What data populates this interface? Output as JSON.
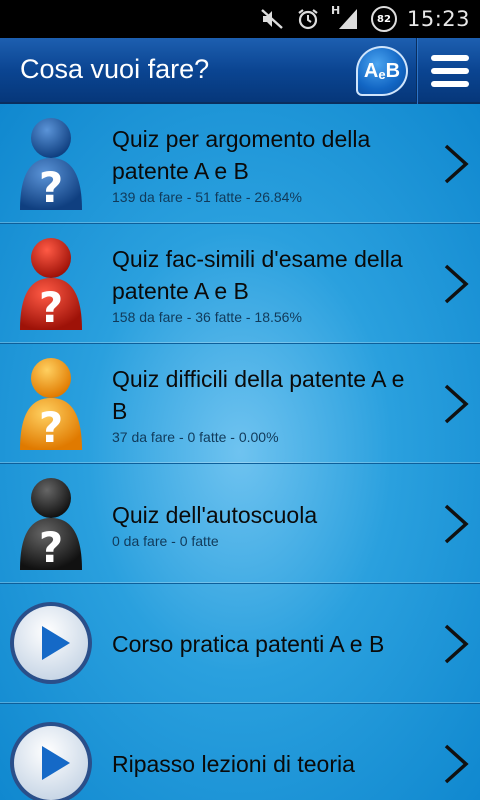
{
  "status_bar": {
    "icons": [
      "mute-icon",
      "alarm-icon",
      "signal-icon"
    ],
    "network_label": "H",
    "battery_level": "82",
    "time": "15:23"
  },
  "header": {
    "title": "Cosa vuoi fare?",
    "logo_text_main": "A",
    "logo_text_small": "e",
    "logo_text_end": "B",
    "menu_icon": "hamburger-menu-icon"
  },
  "colors": {
    "header_blue": "#0b4592",
    "list_background": "#2aa0de",
    "avatar_blue": "#1f5fae",
    "avatar_red": "#d42a1a",
    "avatar_orange": "#f59a12",
    "avatar_black": "#2a2a2a"
  },
  "rows": [
    {
      "type": "quiz",
      "avatar_color": "#1f5fae",
      "label": "Quiz per argomento della patente A e B",
      "stats": "139 da fare - 51 fatte - 26.84%"
    },
    {
      "type": "quiz",
      "avatar_color": "#d42a1a",
      "label": "Quiz fac-simili d'esame della patente A e B",
      "stats": "158 da fare - 36 fatte - 18.56%"
    },
    {
      "type": "quiz",
      "avatar_color": "#f59a12",
      "label": "Quiz difficili della patente A e B",
      "stats": "37 da fare - 0 fatte - 0.00%"
    },
    {
      "type": "quiz",
      "avatar_color": "#2a2a2a",
      "label": "Quiz dell'autoscuola",
      "stats": "0 da fare - 0 fatte"
    },
    {
      "type": "video",
      "label": "Corso pratica patenti A e B",
      "stats": ""
    },
    {
      "type": "video",
      "label": "Ripasso lezioni di teoria",
      "stats": ""
    }
  ]
}
